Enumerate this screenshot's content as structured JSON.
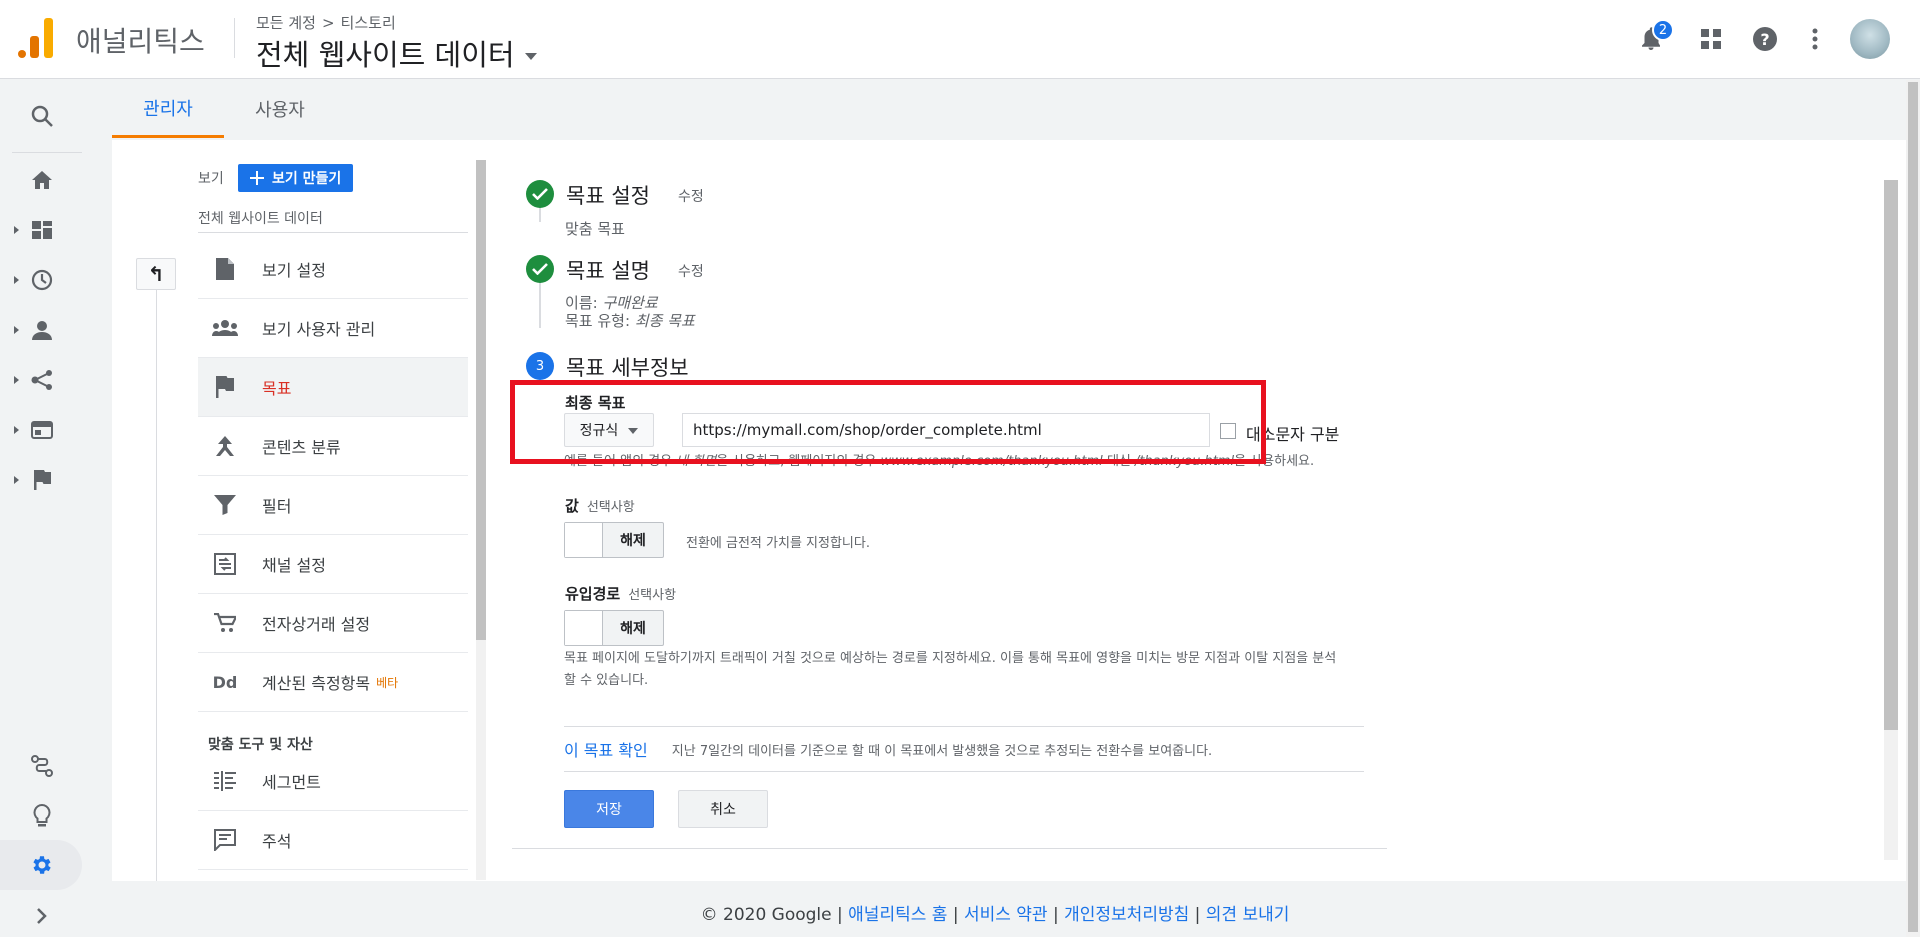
{
  "header": {
    "app_name": "애널리틱스",
    "breadcrumb": [
      "모든 계정",
      "티스토리"
    ],
    "breadcrumb_sep": ">",
    "view_title": "전체 웹사이트 데이터",
    "notification_count": "2"
  },
  "tabs": [
    {
      "label": "관리자",
      "active": true
    },
    {
      "label": "사용자",
      "active": false
    }
  ],
  "admin": {
    "view_label": "보기",
    "create_view": "보기 만들기",
    "view_name": "전체 웹사이트 데이터",
    "menu": [
      {
        "label": "보기 설정",
        "icon": "document-icon"
      },
      {
        "label": "보기 사용자 관리",
        "icon": "people-icon"
      },
      {
        "label": "목표",
        "icon": "flag-icon",
        "active": true
      },
      {
        "label": "콘텐츠 분류",
        "icon": "grouping-icon"
      },
      {
        "label": "필터",
        "icon": "filter-icon"
      },
      {
        "label": "채널 설정",
        "icon": "channel-icon"
      },
      {
        "label": "전자상거래 설정",
        "icon": "cart-icon"
      },
      {
        "label": "계산된 측정항목",
        "icon": "dd-icon",
        "badge": "베타"
      }
    ],
    "section_title": "맞춤 도구 및 자산",
    "menu2": [
      {
        "label": "세그먼트",
        "icon": "segment-icon"
      },
      {
        "label": "주석",
        "icon": "comment-icon"
      }
    ]
  },
  "goal": {
    "step1": {
      "title": "목표 설정",
      "edit": "수정",
      "desc": "맞춤 목표"
    },
    "step2": {
      "title": "목표 설명",
      "edit": "수정",
      "name_label": "이름:",
      "name_value": "구매완료",
      "type_label": "목표 유형:",
      "type_value": "최종 목표"
    },
    "step3": {
      "num": "3",
      "title": "목표 세부정보"
    },
    "destination": {
      "title": "최종 목표",
      "match_type": "정규식",
      "url": "https://mymall.com/shop/order_complete.html",
      "case_label": "대소문자 구분",
      "hint_1": "예를 들어 앱의 경우",
      "hint_2": "내 화면",
      "hint_3": "을 사용하고, 웹페이지의 경우",
      "hint_4": "www.example.com/thankyou.html",
      "hint_5": "대신",
      "hint_6": "/thankyou.html",
      "hint_7": "을 사용하세요."
    },
    "value": {
      "title": "값",
      "optional": "선택사항",
      "toggle": "해제",
      "desc": "전환에 금전적 가치를 지정합니다."
    },
    "funnel": {
      "title": "유입경로",
      "optional": "선택사항",
      "toggle": "해제",
      "desc": "목표 페이지에 도달하기까지 트래픽이 거칠 것으로 예상하는 경로를 지정하세요. 이를 통해 목표에 영향을 미치는 방문 지점과 이탈 지점을 분석할 수 있습니다."
    },
    "verify": {
      "link": "이 목표 확인",
      "desc": "지난 7일간의 데이터를 기준으로 할 때 이 목표에서 발생했을 것으로 추정되는 전환수를 보여줍니다."
    },
    "save": "저장",
    "cancel": "취소"
  },
  "footer": {
    "copyright": "© 2020 Google",
    "sep": "|",
    "links": [
      "애널리틱스 홈",
      "서비스 약관",
      "개인정보처리방침",
      "의견 보내기"
    ]
  }
}
